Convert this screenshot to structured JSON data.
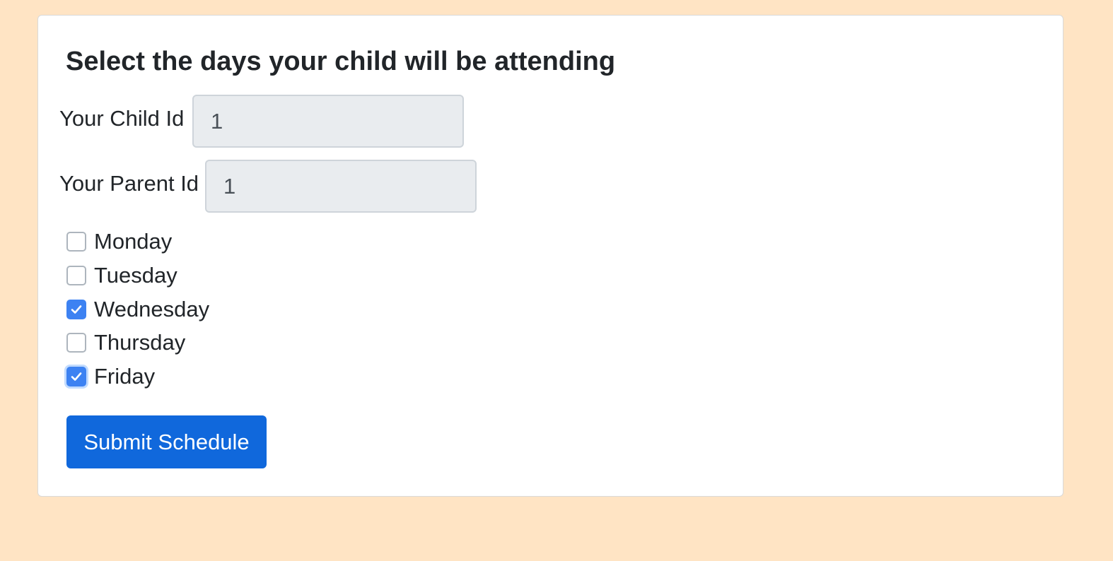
{
  "form": {
    "title": "Select the days your child will be attending",
    "child_id": {
      "label": "Your Child Id",
      "value": "1"
    },
    "parent_id": {
      "label": "Your Parent Id",
      "value": "1"
    },
    "days": [
      {
        "label": "Monday",
        "checked": false
      },
      {
        "label": "Tuesday",
        "checked": false
      },
      {
        "label": "Wednesday",
        "checked": true
      },
      {
        "label": "Thursday",
        "checked": false
      },
      {
        "label": "Friday",
        "checked": true,
        "focused": true
      }
    ],
    "submit_label": "Submit Schedule"
  },
  "colors": {
    "page_background": "#ffe4c4",
    "card_background": "#ffffff",
    "input_background": "#e9ecef",
    "checkbox_checked": "#3d82f2",
    "button_primary": "#1068dc",
    "text": "#212529"
  }
}
